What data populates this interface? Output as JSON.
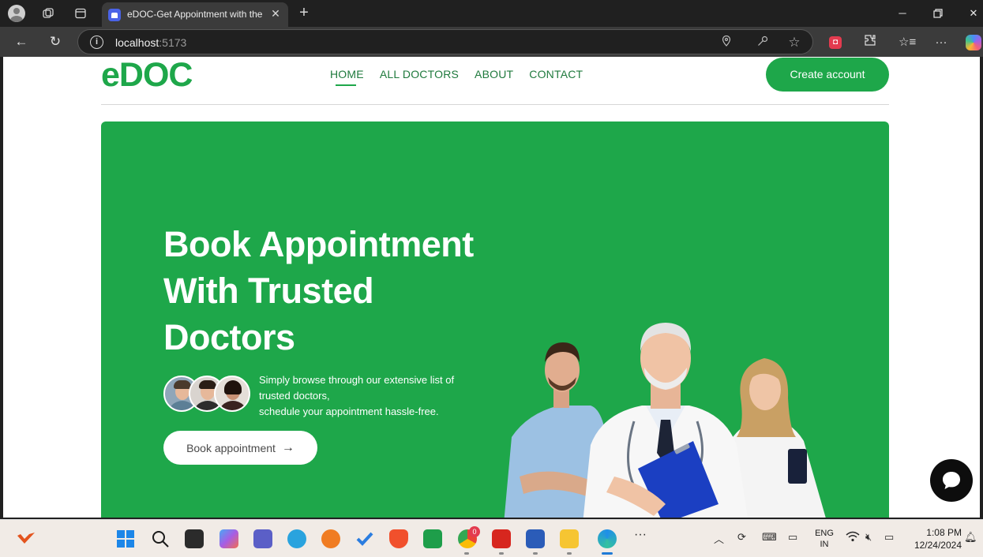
{
  "browser": {
    "tab_title": "eDOC-Get Appointment with the",
    "url_host": "localhost",
    "url_port": ":5173"
  },
  "site": {
    "logo": "eDOC",
    "nav": [
      "HOME",
      "ALL DOCTORS",
      "ABOUT",
      "CONTACT"
    ],
    "create_account": "Create account"
  },
  "hero": {
    "title_lines": [
      "Book Appointment",
      "With Trusted",
      "Doctors"
    ],
    "desc_lines": [
      "Simply browse through our extensive list of",
      "trusted doctors,",
      "schedule your appointment hassle-free."
    ],
    "book_button": "Book appointment",
    "book_arrow": "→"
  },
  "taskbar": {
    "badge_count": "0",
    "lang_line1": "ENG",
    "lang_line2": "IN",
    "time": "1:08 PM",
    "date": "12/24/2024"
  },
  "colors": {
    "brand_green": "#1ea74a",
    "browser_dark": "#202020"
  }
}
